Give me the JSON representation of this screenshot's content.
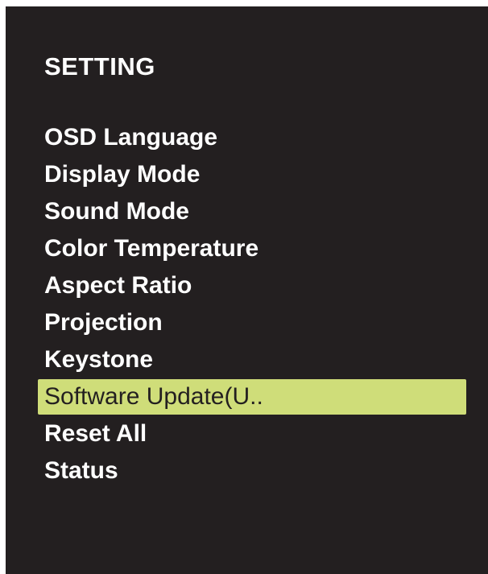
{
  "osd": {
    "title": "SETTING",
    "items": [
      {
        "label": "OSD Language",
        "selected": false
      },
      {
        "label": "Display Mode",
        "selected": false
      },
      {
        "label": "Sound Mode",
        "selected": false
      },
      {
        "label": "Color Temperature",
        "selected": false
      },
      {
        "label": "Aspect Ratio",
        "selected": false
      },
      {
        "label": "Projection",
        "selected": false
      },
      {
        "label": "Keystone",
        "selected": false
      },
      {
        "label": "Software Update(U..",
        "selected": true
      },
      {
        "label": "Reset All",
        "selected": false
      },
      {
        "label": "Status",
        "selected": false
      }
    ],
    "colors": {
      "background": "#231f20",
      "text": "#ffffff",
      "highlight": "#cfdd79",
      "highlight_text": "#231f20"
    }
  }
}
